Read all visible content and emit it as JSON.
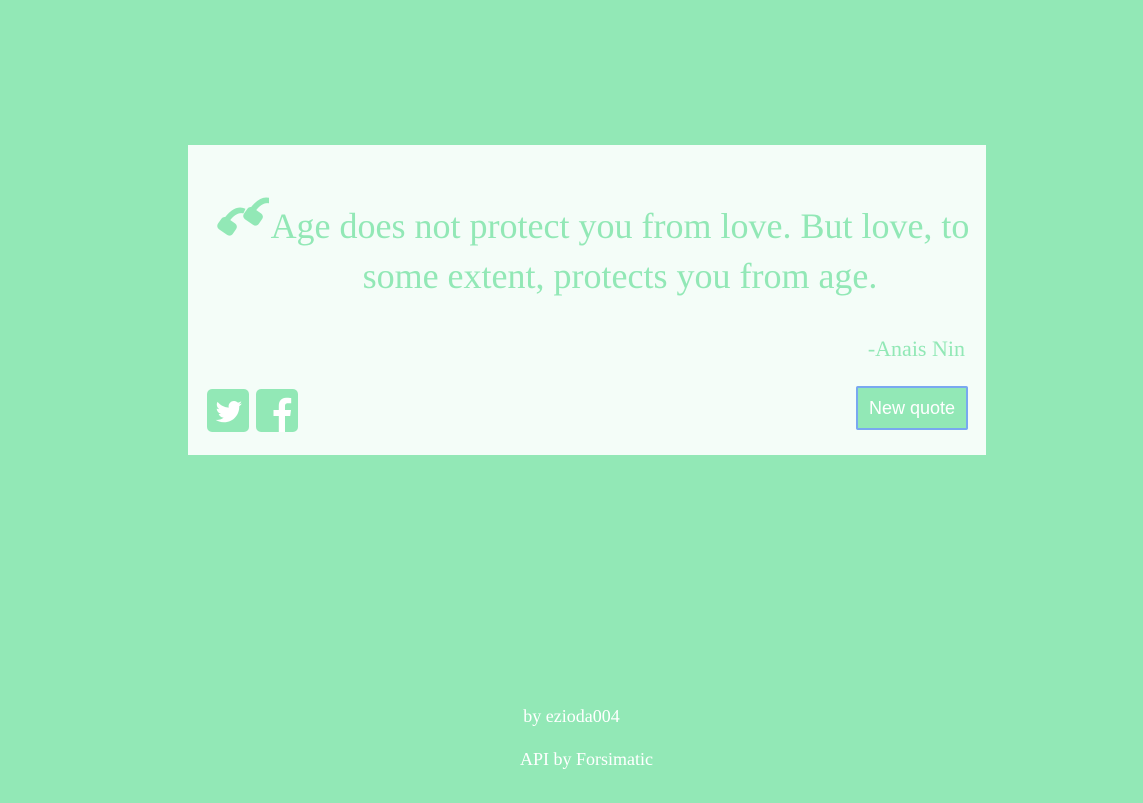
{
  "colors": {
    "background": "#92e8b6",
    "card": "#f4fdf8",
    "accent": "#92e8b6",
    "button_border": "#79a8f0",
    "footer_text": "#ffffff"
  },
  "quote": {
    "icon": "quote-left-icon",
    "text": "Age does not protect you from love. But love, to some extent, protects you from age.",
    "author": "-Anais Nin"
  },
  "social": [
    {
      "icon": "twitter-icon"
    },
    {
      "icon": "facebook-icon"
    }
  ],
  "new_quote_button": "New quote",
  "footer": {
    "by": "by ezioda004",
    "api": "API by Forsimatic"
  }
}
